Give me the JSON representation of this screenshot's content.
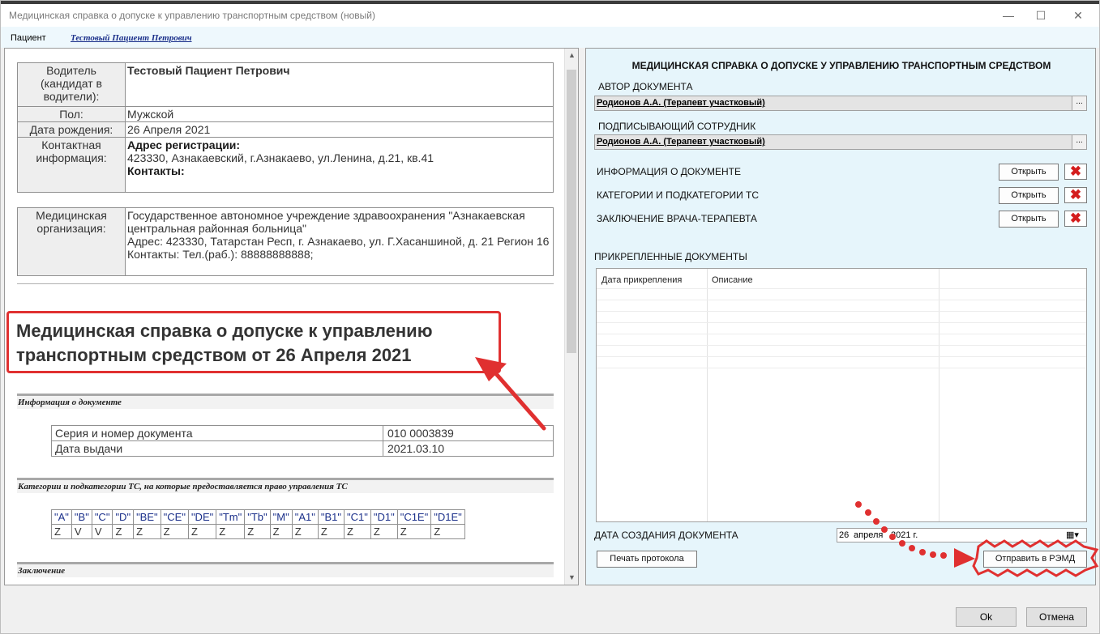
{
  "window": {
    "title": "Медицинская справка о допуске к управлению транспортным средством (новый)"
  },
  "patient": {
    "label": "Пациент",
    "name": "Тестовый Пациент Петрович"
  },
  "doc": {
    "driver": {
      "label": "Водитель (кандидат в водители):",
      "name": "Тестовый Пациент Петрович",
      "sex_label": "Пол:",
      "sex": "Мужской",
      "dob_label": "Дата рождения:",
      "dob": "26 Апреля 2021",
      "contact_label": "Контактная информация:",
      "reg_label": "Адрес регистрации:",
      "reg_address": "423330, Азнакаевский, г.Азнакаево, ул.Ленина, д.21, кв.41",
      "contacts_label": "Контакты:"
    },
    "org": {
      "label": "Медицинская организация:",
      "name": "Государственное автономное учреждение здравоохранения \"Азнакаевская центральная районная больница\"",
      "address": "Адрес: 423330, Татарстан Респ, г. Азнакаево, ул. Г.Хасаншиной, д. 21 Регион 16",
      "contacts": "Контакты: Тел.(раб.): 88888888888;"
    },
    "big_title_line1": "Медицинская справка о допуске к управлению",
    "big_title_line2": "транспортным средством от 26 Апреля 2021",
    "section_info": "Информация о документе",
    "series_label": "Серия и номер документа",
    "series_value": "010 0003839",
    "issue_label": "Дата выдачи",
    "issue_value": "2021.03.10",
    "section_categories": "Категории и подкатегории ТС, на которые предоставляется право управления ТС",
    "categories": [
      "\"A\"",
      "\"B\"",
      "\"C\"",
      "\"D\"",
      "\"BE\"",
      "\"CE\"",
      "\"DE\"",
      "\"Tm\"",
      "\"Tb\"",
      "\"M\"",
      "\"A1\"",
      "\"B1\"",
      "\"C1\"",
      "\"D1\"",
      "\"C1E\"",
      "\"D1E\""
    ],
    "category_values": [
      "Z",
      "V",
      "V",
      "Z",
      "Z",
      "Z",
      "Z",
      "Z",
      "Z",
      "Z",
      "Z",
      "Z",
      "Z",
      "Z",
      "Z",
      "Z"
    ],
    "section_conclusion": "Заключение"
  },
  "right": {
    "title": "МЕДИЦИНСКАЯ СПРАВКА О ДОПУСКЕ У УПРАВЛЕНИЮ ТРАНСПОРТНЫМ СРЕДСТВОМ",
    "author_label": "АВТОР ДОКУМЕНТА",
    "author_value": "Родионов А.А. (Терапевт участковый)",
    "signer_label": "ПОДПИСЫВАЮЩИЙ СОТРУДНИК",
    "signer_value": "Родионов А.А. (Терапевт участковый)",
    "ellipsis": "...",
    "sections": [
      {
        "label": "ИНФОРМАЦИЯ О ДОКУМЕНТЕ",
        "button": "Открыть"
      },
      {
        "label": "КАТЕГОРИИ И ПОДКАТЕГОРИИ ТС",
        "button": "Открыть"
      },
      {
        "label": "ЗАКЛЮЧЕНИЕ ВРАЧА-ТЕРАПЕВТА",
        "button": "Открыть"
      }
    ],
    "attached_label": "ПРИКРЕПЛЕННЫЕ ДОКУМЕНТЫ",
    "grid_col1": "Дата прикрепления",
    "grid_col2": "Описание",
    "date_label": "ДАТА СОЗДАНИЯ ДОКУМЕНТА",
    "date_day": "26",
    "date_month": "апреля",
    "date_year": "2021 г.",
    "print_button": "Печать протокола",
    "send_button": "Отправить в РЭМД"
  },
  "footer": {
    "ok": "Ok",
    "cancel": "Отмена"
  },
  "colors": {
    "annotation": "#e03030",
    "right_panel_bg": "#e6f5fb",
    "link": "#1a2f8a"
  }
}
